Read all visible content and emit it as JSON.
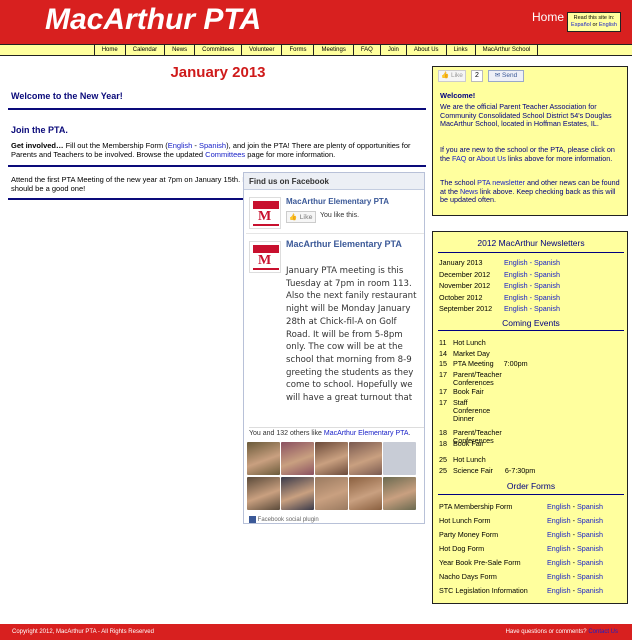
{
  "header": {
    "logo": "MacArthur PTA",
    "home": "Home",
    "lang_line1": "Read this site in:",
    "lang_es": "Español",
    "lang_or": "or",
    "lang_en": "English"
  },
  "nav": [
    "Home",
    "Calendar",
    "News",
    "Committees",
    "Volunteer",
    "Forms",
    "Meetings",
    "FAQ",
    "Join",
    "About Us",
    "Links",
    "MacArthur School"
  ],
  "main": {
    "title": "January 2013",
    "welcome": "Welcome to the New Year!",
    "join_heading": "Join the PTA.",
    "join_bold": "Get involved…",
    "join_t1": " Fill out the Membership Form (",
    "english": "English",
    "dash": " - ",
    "spanish": "Spanish",
    "join_t2": "), and join the PTA! There are plenty of opportunities for Parents and Teachers to be involved. Browse the updated ",
    "committees": "Committees",
    "join_t3": " page for more information.",
    "meeting": "Attend the first PTA Meeting of the new year at 7pm on January 15th. It should be a good one!"
  },
  "facebook": {
    "header": "Find us on Facebook",
    "page_name": "MacArthur Elementary PTA",
    "like": "Like",
    "liked": "You like this.",
    "post_name": "MacArthur Elementary PTA",
    "post_text": "January PTA meeting is this Tuesday at 7pm in room 113. Also the next fanily restaurant night will be Monday January 28th at Chick-fil-A on Golf Road. It will be from 5-8pm only. The cow will be at the school that morning from 8-9 greeting the students as they come to school. Hopefully we will have a great turnout that",
    "count_pre": "You and 132 others like ",
    "count_link": "MacArthur Elementary PTA",
    "count_post": ".",
    "plugin": "Facebook social plugin",
    "face_colors": [
      "#6a5a3a",
      "#8a5060",
      "#6b4a3a",
      "#7a5a50",
      "#c8ccd6",
      "#5a4a3a",
      "#3a3a4a",
      "#9a7a60",
      "#8a6040",
      "#6a6a50"
    ]
  },
  "sidebar": {
    "like": "Like",
    "like_count": "2",
    "send": "Send",
    "welcome": "Welcome!",
    "p1": "We are the official Parent Teacher Association for Community Consolidated School District 54's Douglas MacArthur School, located in Hoffman Estates, IL.",
    "p2_a": "If you are new to the school or the PTA, please click on the ",
    "faq": "FAQ",
    "p2_or": " or ",
    "about": "About Us",
    "p2_b": " links above for more information.",
    "p3_a": "The school ",
    "newsletter": "PTA newsletter",
    "p3_b": " and other news can be found at the ",
    "news": "News",
    "p3_c": " link above. Keep checking back as this will be updated often.",
    "newsletters_h": "2012 MacArthur Newsletters",
    "newsletters": [
      {
        "date": "January 2013"
      },
      {
        "date": "December 2012"
      },
      {
        "date": "November 2012"
      },
      {
        "date": "October 2012"
      },
      {
        "date": "September 2012"
      }
    ],
    "english": "English",
    "dash": " - ",
    "spanish": "Spanish",
    "events_h": "Coming Events",
    "events": [
      {
        "n": "11",
        "t": "Hot Lunch"
      },
      {
        "n": "14",
        "t": "Market Day"
      },
      {
        "n": "15",
        "t": "PTA Meeting     7:00pm"
      },
      {
        "n": "17",
        "t": "Parent/Teacher Conferences"
      },
      {
        "n": "17",
        "t": "Book Fair"
      },
      {
        "n": "17",
        "t": "Staff Conference Dinner"
      },
      {
        "n": "18",
        "t": "Parent/Teacher Conferences"
      },
      {
        "n": "18",
        "t": "Book Fair"
      },
      {
        "n": "25",
        "t": "Hot Lunch"
      },
      {
        "n": "25",
        "t": "Science Fair      6-7:30pm"
      }
    ],
    "forms_h": "Order Forms",
    "forms": [
      "PTA Membership Form",
      "Hot Lunch  Form",
      "Party Money Form",
      "Hot Dog Form",
      "Year Book Pre-Sale Form",
      "Nacho Days Form",
      "STC Legislation Information"
    ]
  },
  "footer": {
    "copyright": "Copyright 2012, MacArthur PTA - All Rights Reserved",
    "questions": "Have questions or comments? ",
    "contact": "Contact Us"
  }
}
